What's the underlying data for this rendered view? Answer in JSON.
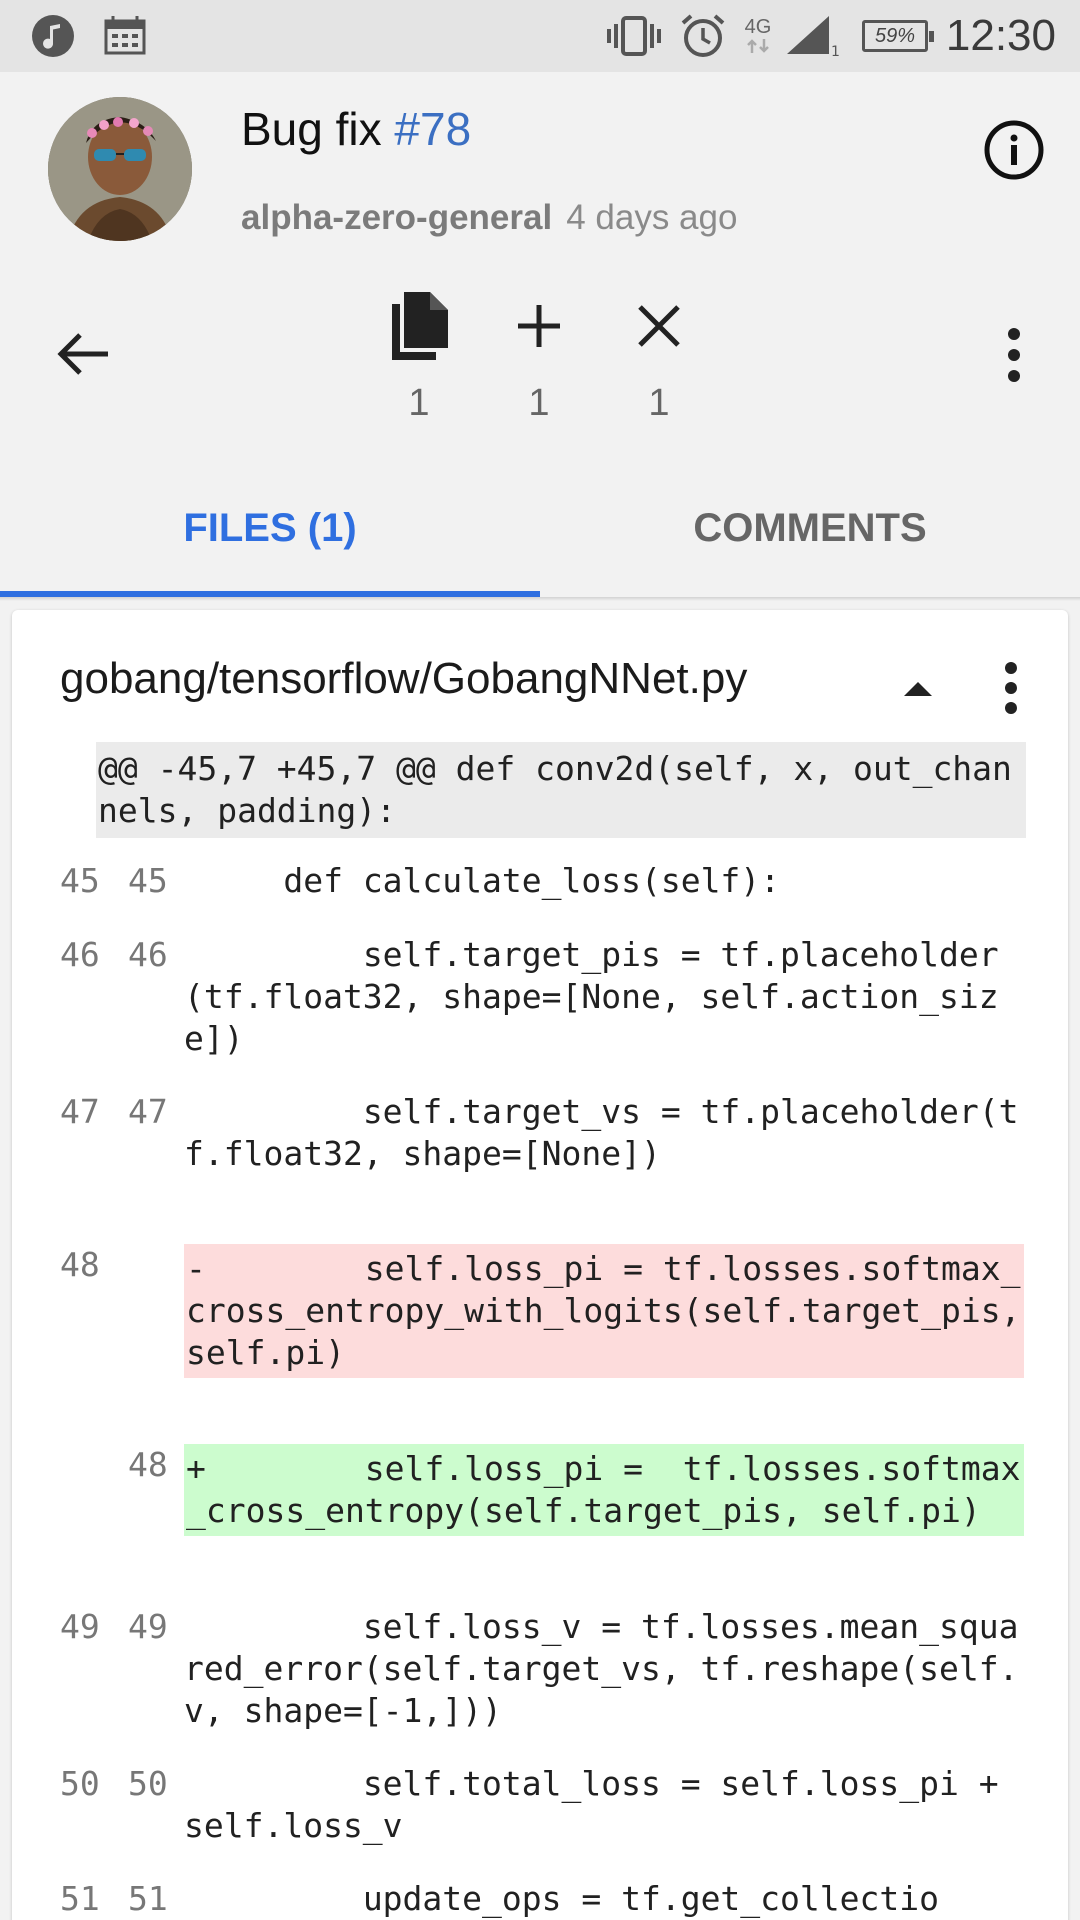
{
  "status_bar": {
    "time": "12:30",
    "battery": "59%",
    "network": "4G",
    "icons": [
      "music-icon",
      "calendar-icon",
      "vibrate-icon",
      "alarm-icon",
      "network-4g-icon",
      "signal-icon",
      "battery-icon"
    ]
  },
  "header": {
    "title": "Bug fix",
    "number": "#78",
    "repo": "alpha-zero-general",
    "time_ago": "4 days ago",
    "stats": {
      "files": "1",
      "additions": "1",
      "deletions": "1"
    }
  },
  "tabs": [
    {
      "label": "FILES (1)",
      "active": true
    },
    {
      "label": "COMMENTS",
      "active": false
    }
  ],
  "file": {
    "path": "gobang/tensorflow/GobangNNet.py",
    "hunk_header": "@@ -45,7 +45,7 @@ def conv2d(self, x, out_channels, padding):",
    "lines": [
      {
        "old": "45",
        "new": "45",
        "type": "context",
        "text": "     def calculate_loss(self):"
      },
      {
        "old": "46",
        "new": "46",
        "type": "context",
        "text": "         self.target_pis = tf.placeholder(tf.float32, shape=[None, self.action_size])"
      },
      {
        "old": "47",
        "new": "47",
        "type": "context",
        "text": "         self.target_vs = tf.placeholder(tf.float32, shape=[None])"
      },
      {
        "old": "48",
        "new": "",
        "type": "del",
        "text": "-        self.loss_pi = tf.losses.softmax_cross_entropy_with_logits(self.target_pis, self.pi)"
      },
      {
        "old": "",
        "new": "48",
        "type": "add",
        "text": "+        self.loss_pi =  tf.losses.softmax_cross_entropy(self.target_pis, self.pi)"
      },
      {
        "old": "49",
        "new": "49",
        "type": "context",
        "text": "         self.loss_v = tf.losses.mean_squared_error(self.target_vs, tf.reshape(self.v, shape=[-1,]))"
      },
      {
        "old": "50",
        "new": "50",
        "type": "context",
        "text": "         self.total_loss = self.loss_pi + self.loss_v"
      },
      {
        "old": "51",
        "new": "51",
        "type": "context",
        "text": "         update_ops = tf.get_collectio"
      }
    ]
  },
  "colors": {
    "accent": "#2f6fe0",
    "link": "#3b6fc2",
    "deleted_bg": "#fddcdc",
    "added_bg": "#ccfcce",
    "hunk_bg": "#ebebeb"
  }
}
